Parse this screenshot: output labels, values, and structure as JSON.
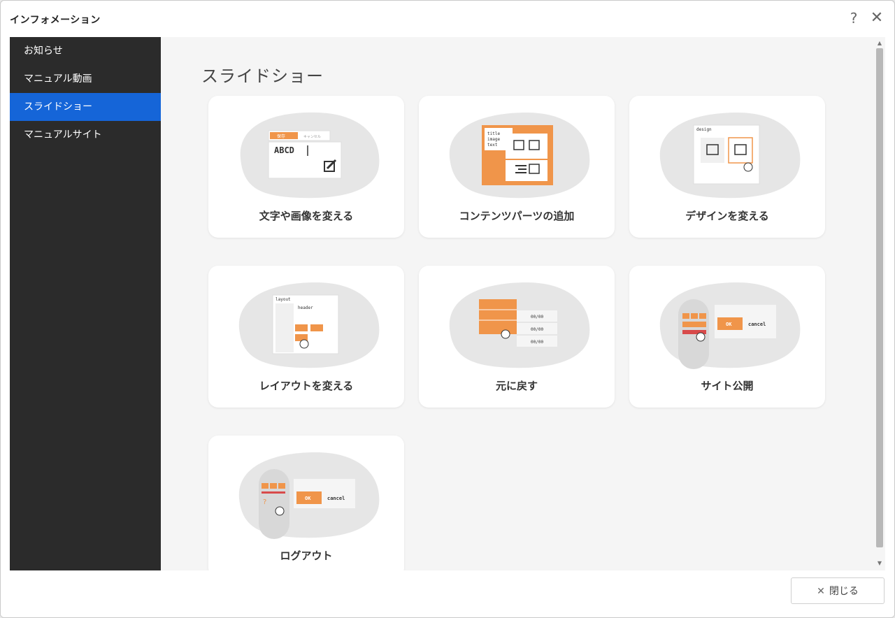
{
  "window": {
    "title": "インフォメーション",
    "help_glyph": "?",
    "close_glyph": "✕"
  },
  "sidebar": {
    "items": [
      {
        "label": "お知らせ"
      },
      {
        "label": "マニュアル動画"
      },
      {
        "label": "スライドショー",
        "active": true
      },
      {
        "label": "マニュアルサイト"
      }
    ]
  },
  "main": {
    "title": "スライドショー",
    "cards": [
      {
        "label": "文字や画像を変える",
        "illustration": "edit-text-image"
      },
      {
        "label": "コンテンツパーツの追加",
        "illustration": "add-content-parts"
      },
      {
        "label": "デザインを変える",
        "illustration": "change-design"
      },
      {
        "label": "レイアウトを変える",
        "illustration": "change-layout"
      },
      {
        "label": "元に戻す",
        "illustration": "undo"
      },
      {
        "label": "サイト公開",
        "illustration": "publish-site"
      },
      {
        "label": "ログアウト",
        "illustration": "logout"
      }
    ]
  },
  "illus_text": {
    "abcd": "ABCD",
    "save": "保存",
    "cancel_jp": "キャンセル",
    "title": "title",
    "image": "image",
    "text": "text",
    "design": "design",
    "layout": "layout",
    "header": "header",
    "timestamp": "00/00",
    "ok": "OK",
    "cancel": "cancel",
    "question": "?"
  },
  "footer": {
    "close_label": "閉じる",
    "close_icon": "✕"
  },
  "colors": {
    "accent": "#1565d8",
    "orange": "#f0954a",
    "sidebar": "#2b2b2b",
    "blob": "#e6e6e6"
  }
}
